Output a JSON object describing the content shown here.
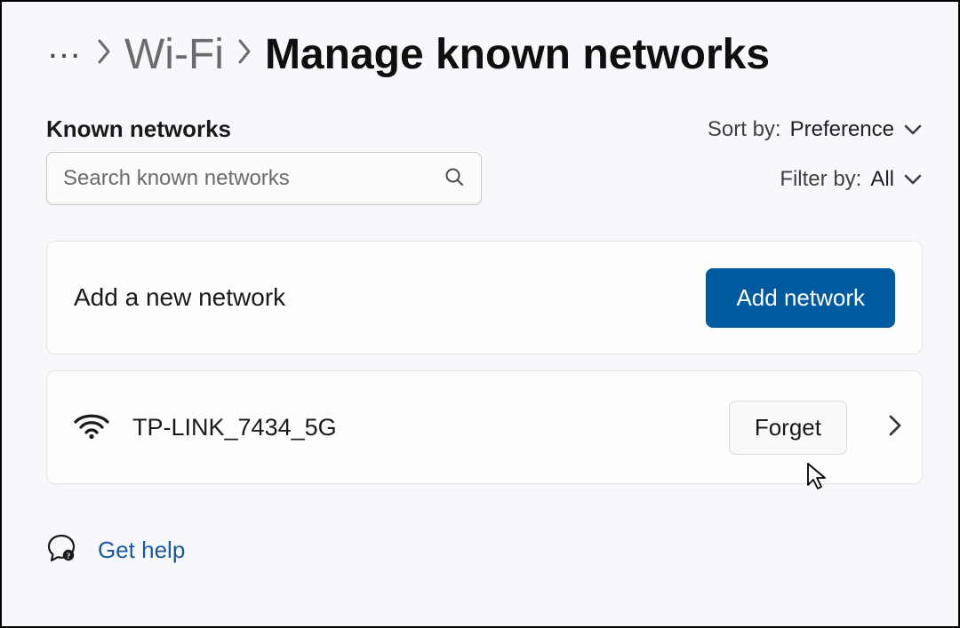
{
  "breadcrumb": {
    "ellipsis": "…",
    "parent": "Wi-Fi",
    "current": "Manage known networks"
  },
  "section": {
    "heading": "Known networks",
    "search_placeholder": "Search known networks"
  },
  "sort": {
    "label": "Sort by:",
    "value": "Preference"
  },
  "filter": {
    "label": "Filter by:",
    "value": "All"
  },
  "add_card": {
    "label": "Add a new network",
    "button": "Add network"
  },
  "networks": [
    {
      "name": "TP-LINK_7434_5G",
      "forget_label": "Forget"
    }
  ],
  "help": {
    "label": "Get help"
  }
}
